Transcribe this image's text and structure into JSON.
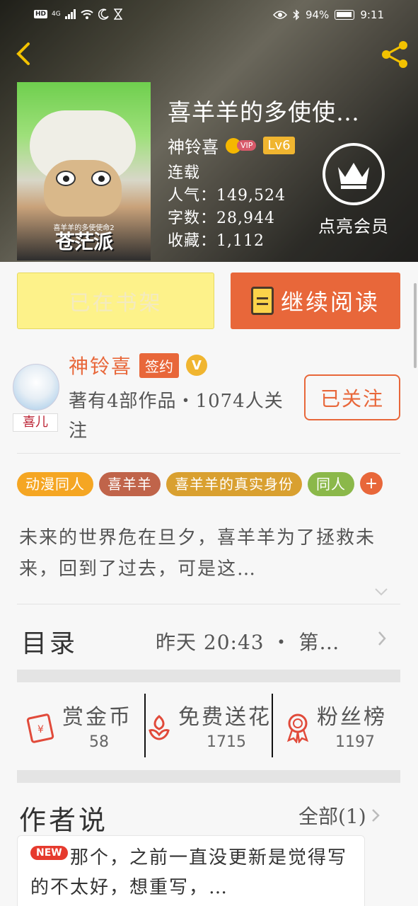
{
  "status_bar": {
    "left_badges": [
      "HD",
      "4G"
    ],
    "battery": "94%",
    "time": "9:11"
  },
  "book": {
    "title": "喜羊羊的多使使…",
    "author": "神铃喜",
    "vip_label": "VIP",
    "level": "Lv6",
    "status": "连载",
    "popularity": "人气：149,524",
    "word_count": "字数：28,944",
    "favorites": "收藏：1,112",
    "cover_caption": "喜羊羊的多使使命2",
    "cover_big_text": "苍茫派",
    "member_label": "点亮会员"
  },
  "actions": {
    "shelf_label": "已在书架",
    "read_label": "继续阅读"
  },
  "author_info": {
    "name": "神铃喜",
    "sign_badge": "签约",
    "verified": "V",
    "description": "著有4部作品・1074人关注",
    "follow_label": "已关注",
    "avatar_tag": "喜儿"
  },
  "tags": [
    {
      "label": "动漫同人",
      "color": "#f5a623"
    },
    {
      "label": "喜羊羊",
      "color": "#c0644a"
    },
    {
      "label": "喜羊羊的真实身份",
      "color": "#d9a030"
    },
    {
      "label": "同人",
      "color": "#8bb84a"
    }
  ],
  "tag_more": "+",
  "synopsis": "未来的世界危在旦夕，喜羊羊为了拯救未来，回到了过去，可是这…",
  "toc": {
    "label": "目录",
    "update": "昨天 20:43 ・ 第…"
  },
  "stats": [
    {
      "name": "赏金币",
      "value": "58",
      "icon": "red-envelope-icon"
    },
    {
      "name": "免费送花",
      "value": "1715",
      "icon": "flower-icon"
    },
    {
      "name": "粉丝榜",
      "value": "1197",
      "icon": "medal-icon"
    }
  ],
  "author_says": {
    "title": "作者说",
    "all_label": "全部(1)",
    "new_badge": "NEW",
    "message": "那个，之前一直没更新是觉得写的不太好，想重写，…"
  },
  "colors": {
    "accent": "#e8673a",
    "shelf_bg": "#fdf28a",
    "level_badge": "#f0b530"
  }
}
